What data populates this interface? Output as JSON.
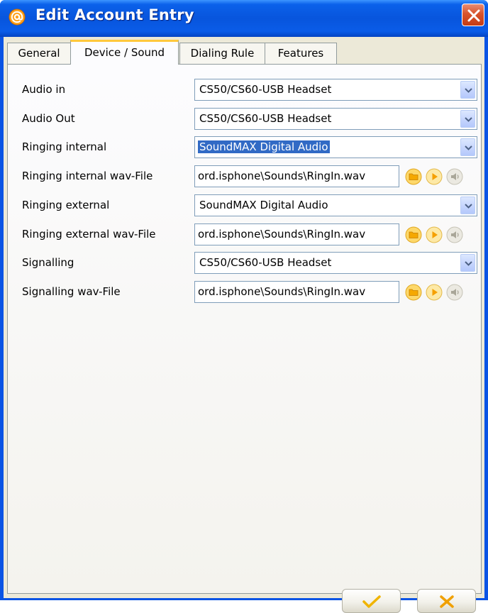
{
  "window": {
    "title": "Edit Account Entry"
  },
  "tabs": [
    {
      "label": "General",
      "active": false
    },
    {
      "label": "Device / Sound",
      "active": true
    },
    {
      "label": "Dialing Rule",
      "active": false
    },
    {
      "label": "Features",
      "active": false
    }
  ],
  "settings": [
    {
      "label": "Audio in",
      "type": "dropdown",
      "value": "CS50/CS60-USB Headset"
    },
    {
      "label": "Audio Out",
      "type": "dropdown",
      "value": "CS50/CS60-USB Headset"
    },
    {
      "label": "Ringing internal",
      "type": "dropdown",
      "value": "SoundMAX Digital Audio",
      "selected": true
    },
    {
      "label": "Ringing internal wav-File",
      "type": "file",
      "value": "ord.isphone\\Sounds\\RingIn.wav"
    },
    {
      "label": "Ringing external",
      "type": "dropdown",
      "value": "SoundMAX Digital Audio"
    },
    {
      "label": "Ringing external wav-File",
      "type": "file",
      "value": "ord.isphone\\Sounds\\RingIn.wav"
    },
    {
      "label": "Signalling",
      "type": "dropdown",
      "value": "CS50/CS60-USB Headset"
    },
    {
      "label": "Signalling wav-File",
      "type": "file",
      "value": "ord.isphone\\Sounds\\RingIn.wav"
    }
  ],
  "icons": {
    "app": "at-sign-icon",
    "close": "close-icon",
    "dropdown": "chevron-down-icon",
    "browse": "folder-icon",
    "play": "play-icon",
    "volume": "speaker-icon",
    "ok": "checkmark-icon",
    "cancel": "x-icon"
  },
  "colors": {
    "titlebar": "#0855dd",
    "dialog_bg": "#ece9d8",
    "selection": "#316ac5",
    "tab_accent": "#ffc83c",
    "ok_accent": "#f0b400",
    "cancel_accent": "#f0a000"
  }
}
